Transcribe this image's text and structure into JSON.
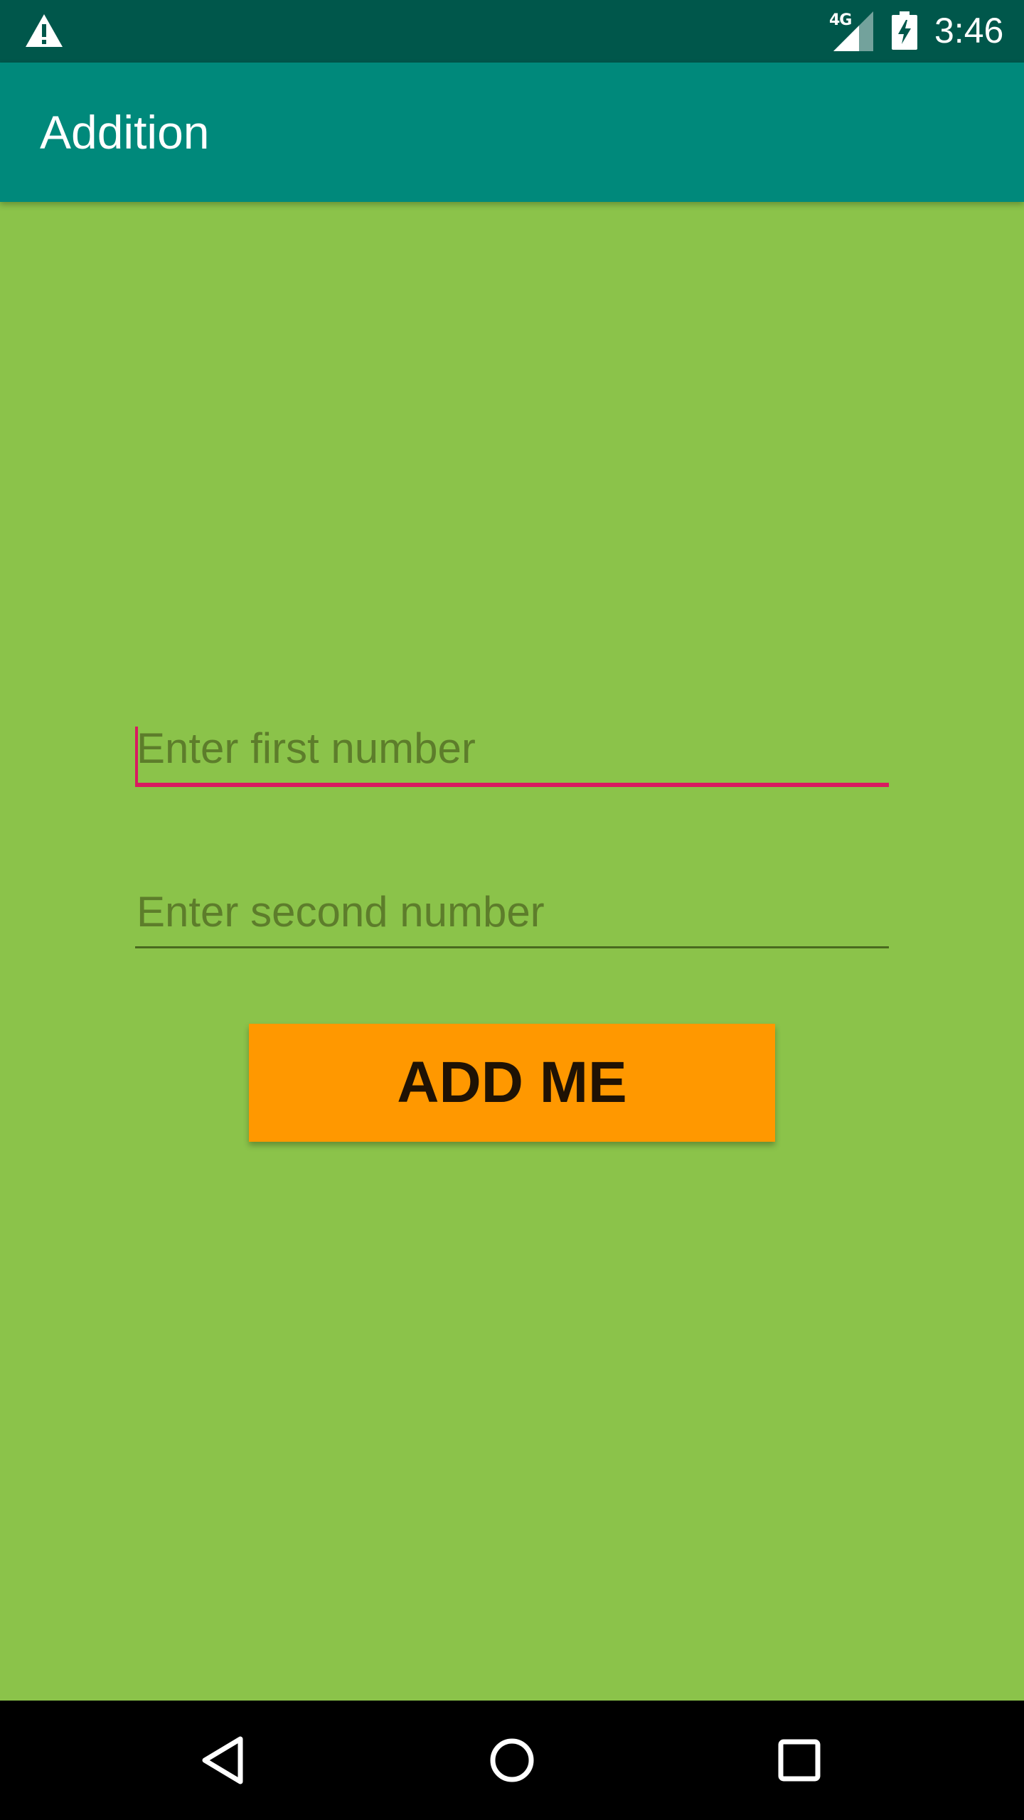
{
  "status_bar": {
    "network_label": "4G",
    "time": "3:46",
    "icons": [
      "warning-icon",
      "cellular-signal-icon",
      "battery-charging-icon"
    ]
  },
  "app_bar": {
    "title": "Addition"
  },
  "form": {
    "first_number": {
      "value": "",
      "placeholder": "Enter first number"
    },
    "second_number": {
      "value": "",
      "placeholder": "Enter second number"
    },
    "add_button_label": "ADD ME"
  },
  "nav_bar": {
    "icons": [
      "back-icon",
      "home-icon",
      "recents-icon"
    ]
  },
  "colors": {
    "status_bar": "#00574b",
    "app_bar": "#00897b",
    "background": "#8bc34a",
    "accent": "#d81b60",
    "button": "#ff9800"
  }
}
